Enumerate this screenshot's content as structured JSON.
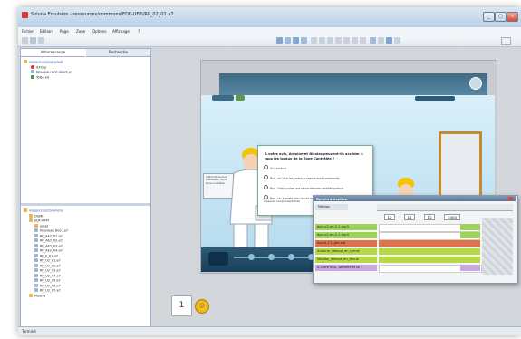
{
  "window": {
    "title": "Soluna Emulsion - ressources/commons/EDF-UFPI/RP_02_02.a7",
    "controls": [
      "_",
      "□",
      "×"
    ]
  },
  "menu": [
    "Fichier",
    "Edition",
    "Page",
    "Zone",
    "Options",
    "Affichage",
    "?"
  ],
  "left_panel": {
    "tabs": [
      "Arborescence",
      "Recherche"
    ],
    "tree_top": [
      {
        "label": "ressources/users/root",
        "icon": "folder-icon"
      },
      {
        "label": "0Ximp",
        "icon": "error-icon"
      },
      {
        "label": "Nouveau Document.a7",
        "icon": "document-icon"
      },
      {
        "label": "ToDo.xls",
        "icon": "spreadsheet-icon"
      }
    ],
    "tree_bottom": [
      {
        "label": "ressources/Commons",
        "icon": "folder-icon"
      },
      {
        "label": "DGME",
        "icon": "folder-icon"
      },
      {
        "label": "EDF-UFPI",
        "icon": "folder-icon"
      },
      {
        "label": "asset",
        "icon": "folder-icon"
      },
      {
        "label": "Nouveau Docu.a7",
        "icon": "document-icon"
      },
      {
        "label": "RP_AE2_01.a7",
        "icon": "document-icon"
      },
      {
        "label": "RP_AE2_02.a7",
        "icon": "document-icon"
      },
      {
        "label": "RP_AE2_03.a7",
        "icon": "document-icon"
      },
      {
        "label": "RP_AE2_04.a7",
        "icon": "document-icon"
      },
      {
        "label": "RP_F_01.a7",
        "icon": "document-icon"
      },
      {
        "label": "RP_U2_01.a7",
        "icon": "document-icon"
      },
      {
        "label": "RP_U2_02.a7",
        "icon": "document-icon"
      },
      {
        "label": "RP_U2_03.a7",
        "icon": "document-icon"
      },
      {
        "label": "RP_U2_04.a7",
        "icon": "document-icon"
      },
      {
        "label": "RP_U2_05.a7",
        "icon": "document-icon"
      },
      {
        "label": "RP_U2_06.a7",
        "icon": "document-icon"
      },
      {
        "label": "RP_U2_07.a7",
        "icon": "document-icon"
      },
      {
        "label": "Medias",
        "icon": "folder-icon"
      }
    ]
  },
  "slide": {
    "question": "A votre avis, Antoine et Nicolas peuvent-ils accéder à tous les locaux de la Zone Contrôlée ?",
    "answers": [
      "Oui, partout",
      "Non, car tous les locaux à risques sont condamnés",
      "Non, il faut porter une tenue étanche ventilée partout",
      "Non, car il existe des risques pour lesquels il faudra prendre des mesures complémentaires"
    ],
    "board_text": "Instructions pour l'utilisation de la zone contrôlée"
  },
  "sync_panel": {
    "title": "Synchronisation",
    "header_label": "Médias",
    "controls": [
      "12",
      "11",
      "13",
      "1000"
    ],
    "rows": [
      {
        "label": "dpn-u2-en-2-1.mp3",
        "color": "#9fd25b"
      },
      {
        "label": "dpn-u2-en-2-1.mp3",
        "color": "#9fd25b"
      },
      {
        "label": "Avant_C1_gfx.swf",
        "color": "#e0724b"
      },
      {
        "label": "Antoine_debout_en_tenue",
        "color": "#b7d948"
      },
      {
        "label": "Nicolas_debout_en_tenue",
        "color": "#b7d948"
      },
      {
        "label": "A votre avis, Antoine et Ni",
        "color": "#c9a7e3"
      }
    ]
  },
  "thumbnails": {
    "page_number": "1"
  },
  "status": "Terminé",
  "colors": {
    "accent": "#5b7597",
    "tree_link": "#1f4fb5"
  }
}
